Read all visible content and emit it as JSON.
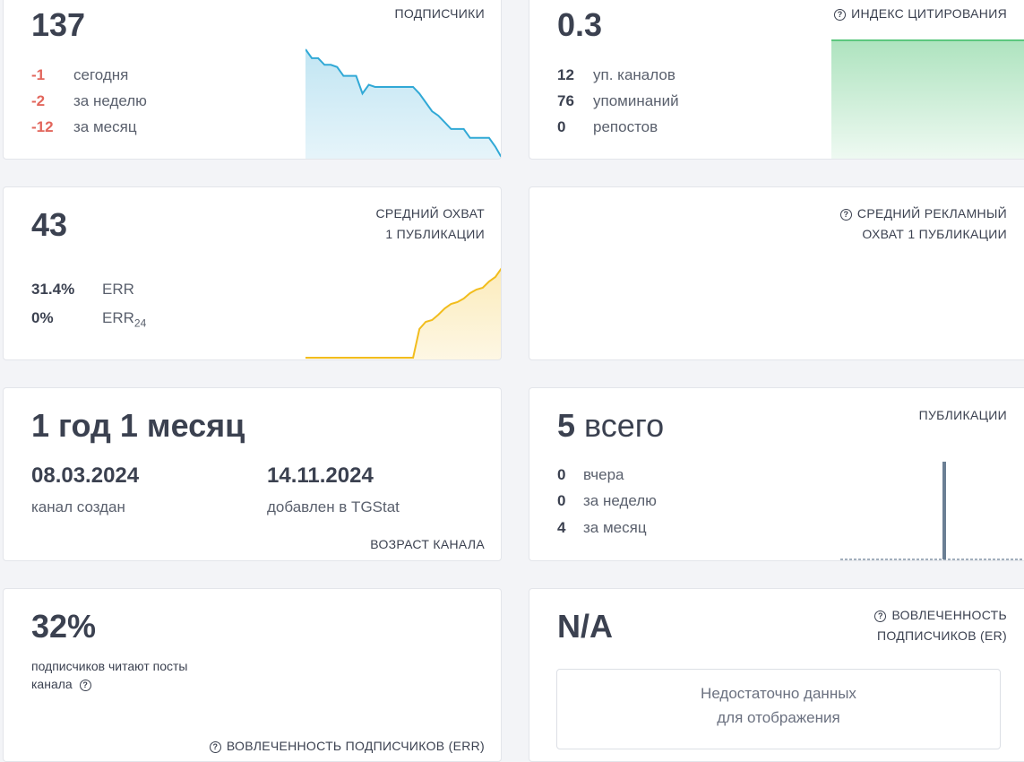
{
  "subscribers": {
    "value": "137",
    "label": "ПОДПИСЧИКИ",
    "today_value": "-1",
    "today_label": "сегодня",
    "week_value": "-2",
    "week_label": "за неделю",
    "month_value": "-12",
    "month_label": "за месяц",
    "trend": [
      100,
      96,
      96,
      93,
      93,
      92,
      88,
      88,
      88,
      80,
      84,
      83,
      83,
      83,
      83,
      83,
      83,
      83,
      80,
      76,
      72,
      70,
      67,
      64,
      64,
      64,
      60,
      60,
      60,
      60,
      56,
      51
    ],
    "color": "#31a9d6"
  },
  "citation": {
    "value": "0.3",
    "label": "ИНДЕКС ЦИТИРОВАНИЯ",
    "channels_value": "12",
    "channels_label": "уп. каналов",
    "mentions_value": "76",
    "mentions_label": "упоминаний",
    "reposts_value": "0",
    "reposts_label": "репостов",
    "color": "#5cc77e"
  },
  "reach": {
    "value": "43",
    "label_line1": "СРЕДНИЙ ОХВАТ",
    "label_line2": "1 ПУБЛИКАЦИИ",
    "err_value": "31.4%",
    "err_label": "ERR",
    "err24_value": "0%",
    "err24_label": "ERR",
    "err24_sub": "24",
    "trend": [
      0,
      0,
      0,
      0,
      0,
      0,
      0,
      0,
      0,
      0,
      0,
      0,
      0,
      0,
      0,
      0,
      0,
      0,
      32,
      40,
      42,
      48,
      55,
      60,
      62,
      66,
      72,
      76,
      78,
      85,
      90,
      100
    ],
    "color": "#f2bd1d"
  },
  "ad_reach": {
    "label_line1": "СРЕДНИЙ РЕКЛАМНЫЙ",
    "label_line2": "ОХВАТ 1 ПУБЛИКАЦИИ"
  },
  "age": {
    "value": "1 год 1 месяц",
    "created_date": "08.03.2024",
    "created_label": "канал создан",
    "added_date": "14.11.2024",
    "added_label": "добавлен в TGStat",
    "label": "ВОЗРАСТ КАНАЛА"
  },
  "publications": {
    "value_num": "5",
    "value_text": "всего",
    "label": "ПУБЛИКАЦИИ",
    "yesterday_value": "0",
    "yesterday_label": "вчера",
    "week_value": "0",
    "week_label": "за неделю",
    "month_value": "4",
    "month_label": "за месяц",
    "bar_color": "#6b7f94"
  },
  "err_card": {
    "value": "32%",
    "desc_line1": "подписчиков читают посты",
    "desc_line2": "канала",
    "label": "ВОВЛЕЧЕННОСТЬ ПОДПИСЧИКОВ (ERR)"
  },
  "er_card": {
    "value": "N/A",
    "label_line1": "ВОВЛЕЧЕННОСТЬ",
    "label_line2": "ПОДПИСЧИКОВ (ER)",
    "nodata_line1": "Недостаточно данных",
    "nodata_line2": "для отображения"
  }
}
